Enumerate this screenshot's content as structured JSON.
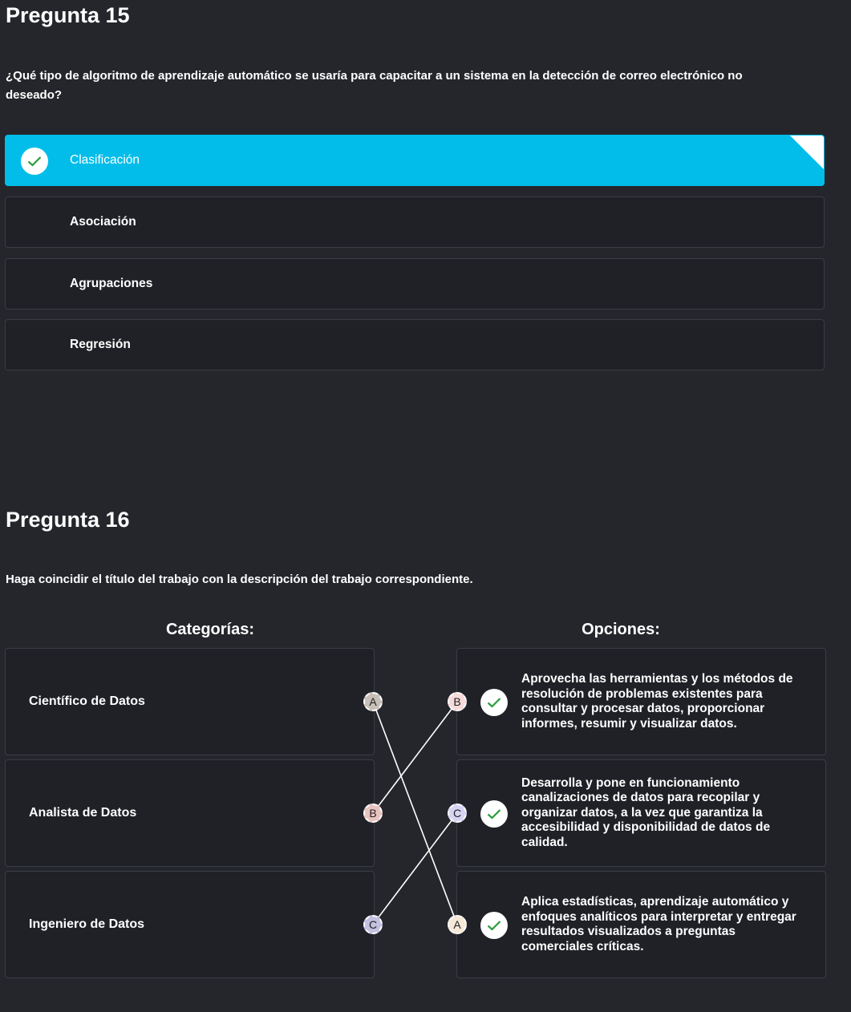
{
  "q15": {
    "title": "Pregunta 15",
    "question": "¿Qué tipo de algoritmo de aprendizaje automático se usaría para capacitar a un sistema en la detección de correo electrónico no deseado?",
    "options": [
      {
        "label": "Clasificación",
        "selected": true
      },
      {
        "label": "Asociación",
        "selected": false
      },
      {
        "label": "Agrupaciones",
        "selected": false
      },
      {
        "label": "Regresión",
        "selected": false
      }
    ]
  },
  "q16": {
    "title": "Pregunta 16",
    "question": "Haga coincidir el título del trabajo con la descripción del trabajo correspondiente.",
    "categories_header": "Categorías:",
    "options_header": "Opciones:",
    "categories": [
      {
        "label": "Científico de Datos",
        "letter": "A"
      },
      {
        "label": "Analista de Datos",
        "letter": "B"
      },
      {
        "label": "Ingeniero de Datos",
        "letter": "C"
      }
    ],
    "options": [
      {
        "letter": "B",
        "text": "Aprovecha las herramientas y los métodos de resolución de problemas existentes para consultar y procesar datos, proporcionar informes, resumir y visualizar datos.",
        "correct": true
      },
      {
        "letter": "C",
        "text": "Desarrolla y pone en funcionamiento canalizaciones de datos para recopilar y organizar datos, a la vez que garantiza la accesibilidad y disponibilidad de datos de calidad.",
        "correct": true
      },
      {
        "letter": "A",
        "text": "Aplica estadísticas, aprendizaje automático y enfoques analíticos para interpretar y entregar resultados visualizados a preguntas comerciales críticas.",
        "correct": true
      }
    ]
  },
  "colors": {
    "background": "#24262b",
    "selected": "#02bde9",
    "check": "#2a9d3a",
    "token_a": "#c8c0b8",
    "token_b": "#e8c4c0",
    "token_c": "#c4c0e0",
    "token_a_right": "#f6e8d8",
    "token_b_right": "#f6dada",
    "token_c_right": "#d6d4f2"
  }
}
